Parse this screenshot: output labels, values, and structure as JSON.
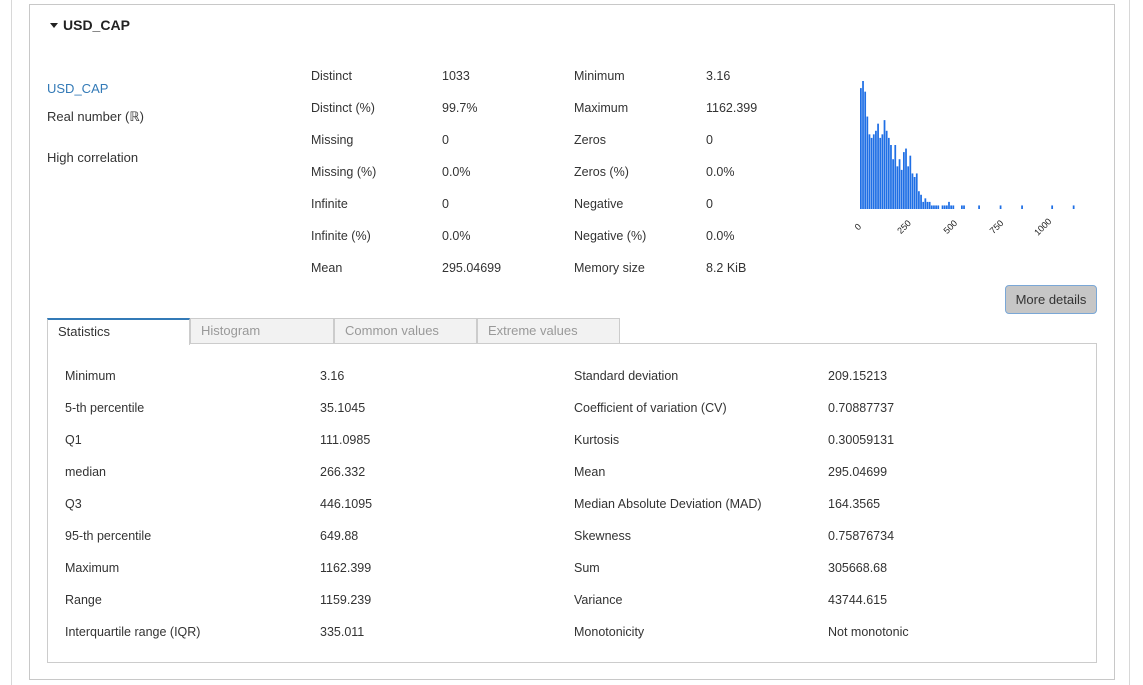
{
  "variable": {
    "header": "USD_CAP",
    "name": "USD_CAP",
    "type": "Real number (ℝ)",
    "alert": "High correlation"
  },
  "overview": {
    "left": [
      {
        "label": "Distinct",
        "value": "1033"
      },
      {
        "label": "Distinct (%)",
        "value": "99.7%"
      },
      {
        "label": "Missing",
        "value": "0"
      },
      {
        "label": "Missing (%)",
        "value": "0.0%"
      },
      {
        "label": "Infinite",
        "value": "0"
      },
      {
        "label": "Infinite (%)",
        "value": "0.0%"
      },
      {
        "label": "Mean",
        "value": "295.04699"
      }
    ],
    "right": [
      {
        "label": "Minimum",
        "value": "3.16"
      },
      {
        "label": "Maximum",
        "value": "1162.399"
      },
      {
        "label": "Zeros",
        "value": "0"
      },
      {
        "label": "Zeros (%)",
        "value": "0.0%"
      },
      {
        "label": "Negative",
        "value": "0"
      },
      {
        "label": "Negative (%)",
        "value": "0.0%"
      },
      {
        "label": "Memory size",
        "value": "8.2 KiB"
      }
    ]
  },
  "more_details_label": "More details",
  "tabs": [
    {
      "label": "Statistics",
      "active": true
    },
    {
      "label": "Histogram",
      "active": false
    },
    {
      "label": "Common values",
      "active": false
    },
    {
      "label": "Extreme values",
      "active": false
    }
  ],
  "statistics": {
    "quantile": [
      {
        "label": "Minimum",
        "value": "3.16"
      },
      {
        "label": "5-th percentile",
        "value": "35.1045"
      },
      {
        "label": "Q1",
        "value": "111.0985"
      },
      {
        "label": "median",
        "value": "266.332"
      },
      {
        "label": "Q3",
        "value": "446.1095"
      },
      {
        "label": "95-th percentile",
        "value": "649.88"
      },
      {
        "label": "Maximum",
        "value": "1162.399"
      },
      {
        "label": "Range",
        "value": "1159.239"
      },
      {
        "label": "Interquartile range (IQR)",
        "value": "335.011"
      }
    ],
    "descriptive": [
      {
        "label": "Standard deviation",
        "value": "209.15213"
      },
      {
        "label": "Coefficient of variation (CV)",
        "value": "0.70887737"
      },
      {
        "label": "Kurtosis",
        "value": "0.30059131"
      },
      {
        "label": "Mean",
        "value": "295.04699"
      },
      {
        "label": "Median Absolute Deviation (MAD)",
        "value": "164.3565"
      },
      {
        "label": "Skewness",
        "value": "0.75876734"
      },
      {
        "label": "Sum",
        "value": "305668.68"
      },
      {
        "label": "Variance",
        "value": "43744.615"
      },
      {
        "label": "Monotonicity",
        "value": "Not monotonic"
      }
    ]
  },
  "chart_data": {
    "type": "bar",
    "title": "",
    "xlabel": "",
    "ylabel": "",
    "x_ticks": [
      "0",
      "250",
      "500",
      "750",
      "1000"
    ],
    "xlim": [
      0,
      1162.399
    ],
    "bin_width": 11.62,
    "bar_color": "#1f6fe5",
    "bin_counts": [
      34,
      36,
      33,
      26,
      21,
      20,
      21,
      22,
      24,
      20,
      21,
      25,
      22,
      20,
      18,
      14,
      18,
      12,
      14,
      11,
      16,
      17,
      12,
      15,
      10,
      9,
      10,
      5,
      4,
      2,
      3,
      2,
      2,
      1,
      1,
      1,
      1,
      0,
      1,
      1,
      1,
      2,
      1,
      1,
      0,
      0,
      0,
      1,
      1,
      0,
      0,
      0,
      0,
      0,
      0,
      1,
      0,
      0,
      0,
      0,
      0,
      0,
      0,
      0,
      0,
      1,
      0,
      0,
      0,
      0,
      0,
      0,
      0,
      0,
      0,
      1,
      0,
      0,
      0,
      0,
      0,
      0,
      0,
      0,
      0,
      0,
      0,
      0,
      0,
      1,
      0,
      0,
      0,
      0,
      0,
      0,
      0,
      0,
      0,
      1
    ]
  }
}
